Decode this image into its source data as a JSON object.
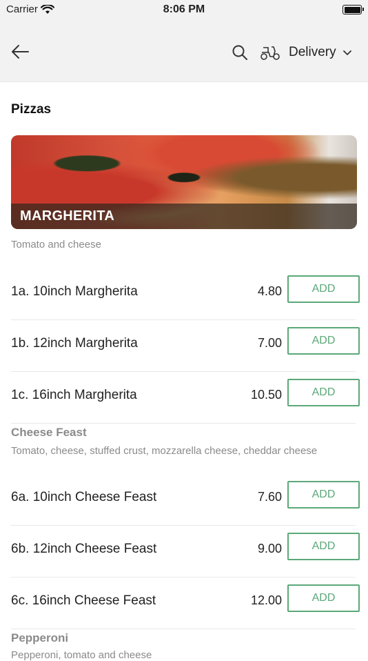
{
  "status_bar": {
    "carrier": "Carrier",
    "time": "8:06 PM"
  },
  "header": {
    "back_icon": "arrow-left-icon",
    "search_icon": "search-icon",
    "delivery_icon": "scooter-icon",
    "delivery_label": "Delivery"
  },
  "section": {
    "title": "Pizzas"
  },
  "margherita": {
    "banner_title": "MARGHERITA",
    "description": "Tomato and cheese",
    "items": [
      {
        "name": "1a. 10inch Margherita",
        "price": "4.80",
        "button": "ADD"
      },
      {
        "name": "1b. 12inch Margherita",
        "price": "7.00",
        "button": "ADD"
      },
      {
        "name": "1c. 16inch Margherita",
        "price": "10.50",
        "button": "ADD"
      }
    ]
  },
  "cheese_feast": {
    "title": "Cheese Feast",
    "description": "Tomato, cheese, stuffed crust, mozzarella cheese, cheddar cheese",
    "items": [
      {
        "name": "6a. 10inch Cheese Feast",
        "price": "7.60",
        "button": "ADD"
      },
      {
        "name": "6b. 12inch Cheese Feast",
        "price": "9.00",
        "button": "ADD"
      },
      {
        "name": "6c. 16inch Cheese Feast",
        "price": "12.00",
        "button": "ADD"
      }
    ]
  },
  "pepperoni": {
    "title": "Pepperoni",
    "description": "Pepperoni, tomato and cheese"
  },
  "colors": {
    "accent": "#5aa878",
    "header_bg": "#f2f2f2",
    "muted_text": "#8a8a8a"
  }
}
